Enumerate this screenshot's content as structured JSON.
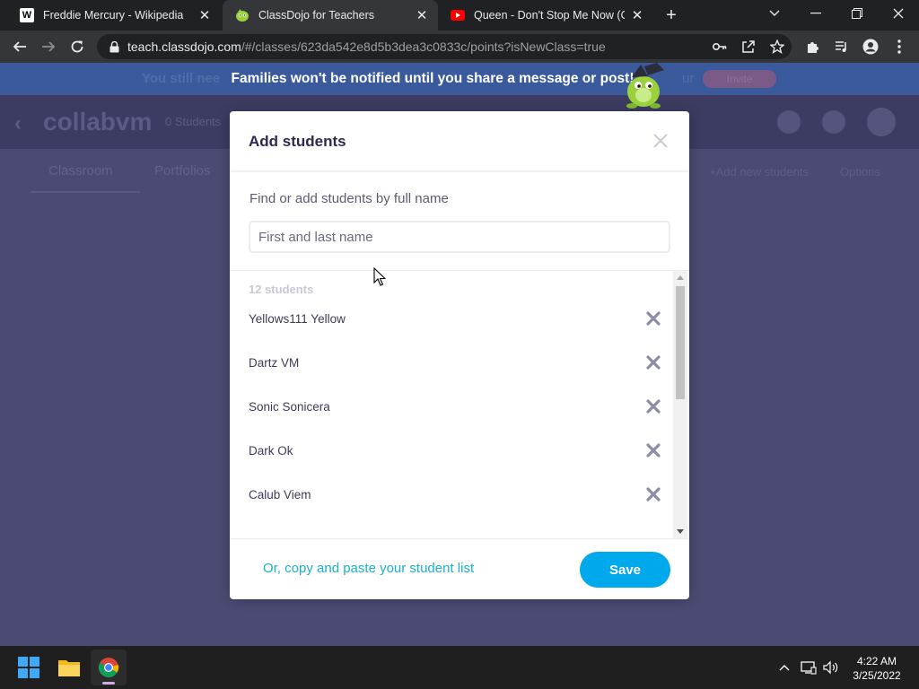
{
  "browser": {
    "tabs": [
      {
        "title": "Freddie Mercury - Wikipedia",
        "favicon": "wikipedia-icon",
        "active": false
      },
      {
        "title": "ClassDojo for Teachers",
        "favicon": "classdojo-icon",
        "active": true
      },
      {
        "title": "Queen - Don't Stop Me Now (Off",
        "favicon": "youtube-icon",
        "active": false
      }
    ],
    "url_host": "teach.classdojo.com",
    "url_path": "/#/classes/623da542e8d5b3dea3c0833c/points?isNewClass=true"
  },
  "banner": {
    "message": "Families won't be notified until you share a message or post!",
    "ghost_left": "You still nee",
    "ghost_right": "ur",
    "ghost_button": "Invite"
  },
  "class_header": {
    "name": "collabvm",
    "student_count": "0 Students"
  },
  "subnav": {
    "tabs": [
      "Classroom",
      "Portfolios"
    ],
    "right_link": "+Add new students",
    "right_menu": "Options"
  },
  "modal": {
    "title": "Add students",
    "field_label": "Find or add students by full name",
    "input_placeholder": "First and last name",
    "input_value": "",
    "student_count_label": "12 students",
    "students": [
      "Yellows111 Yellow",
      "Dartz VM",
      "Sonic Sonicera",
      "Dark Ok",
      "Calub Viem"
    ],
    "paste_link": "Or, copy and paste your student list",
    "save_label": "Save"
  },
  "taskbar": {
    "apps": [
      "start-icon",
      "file-explorer-icon",
      "chrome-icon"
    ],
    "time": "4:22 AM",
    "date": "3/25/2022"
  },
  "colors": {
    "accent_blue": "#00a8ec",
    "link_teal": "#1ab1c9",
    "overlay_purple": "#4b4a72"
  }
}
